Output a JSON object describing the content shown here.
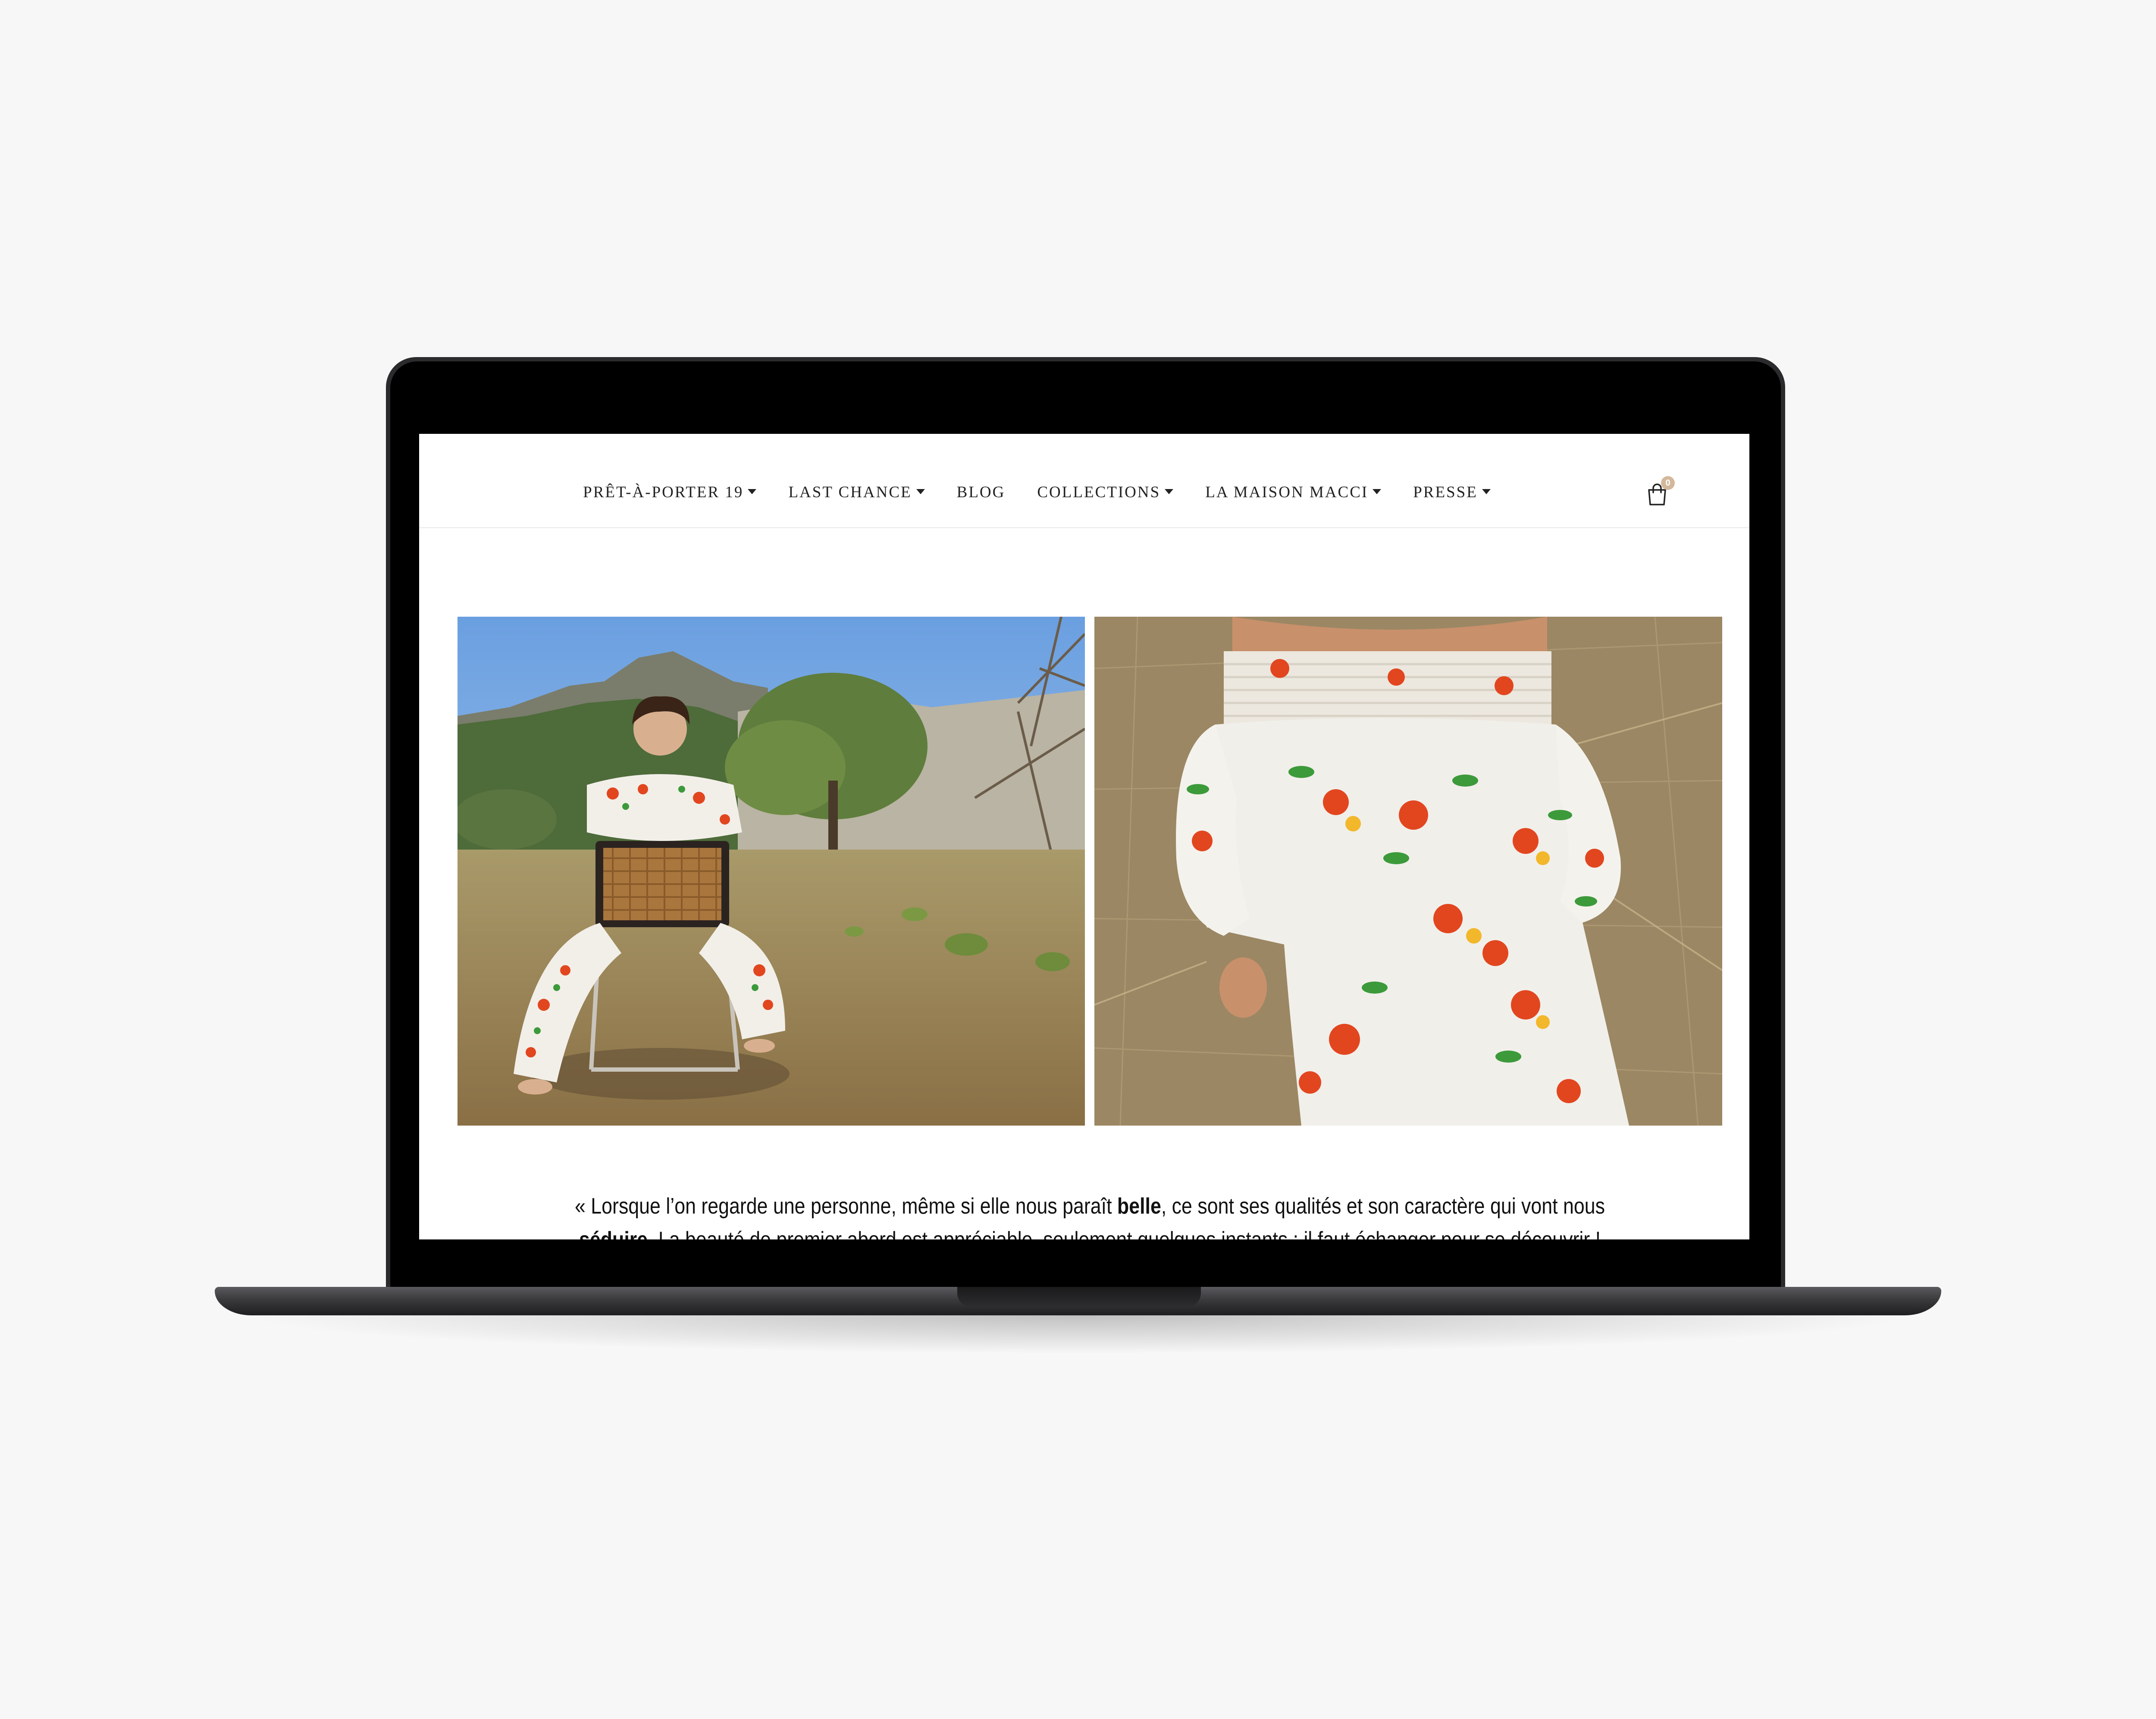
{
  "nav": {
    "items": [
      {
        "label": "PRÊT-À-PORTER 19",
        "dropdown": true
      },
      {
        "label": "LAST CHANCE",
        "dropdown": true
      },
      {
        "label": "BLOG",
        "dropdown": false
      },
      {
        "label": "COLLECTIONS",
        "dropdown": true
      },
      {
        "label": "LA MAISON MACCI",
        "dropdown": true
      },
      {
        "label": "PRESSE",
        "dropdown": true
      }
    ],
    "cart_count": "0",
    "cart_icon": "shopping-bag-icon"
  },
  "quote": {
    "part1": "« Lorsque l’on regarde une personne, même si elle nous paraît ",
    "bold1": "belle",
    "part2": ", ce sont ses qualités et son caractère qui vont nous ",
    "bold2": "séduire",
    "part3": ". La beauté de premier abord est appréciable, seulement quelques instants : il faut échanger pour se découvrir !"
  },
  "colors": {
    "cart_badge": "#d3b89b",
    "page_background": "#f7f7f7",
    "device_frame": "#2b2b2d"
  }
}
